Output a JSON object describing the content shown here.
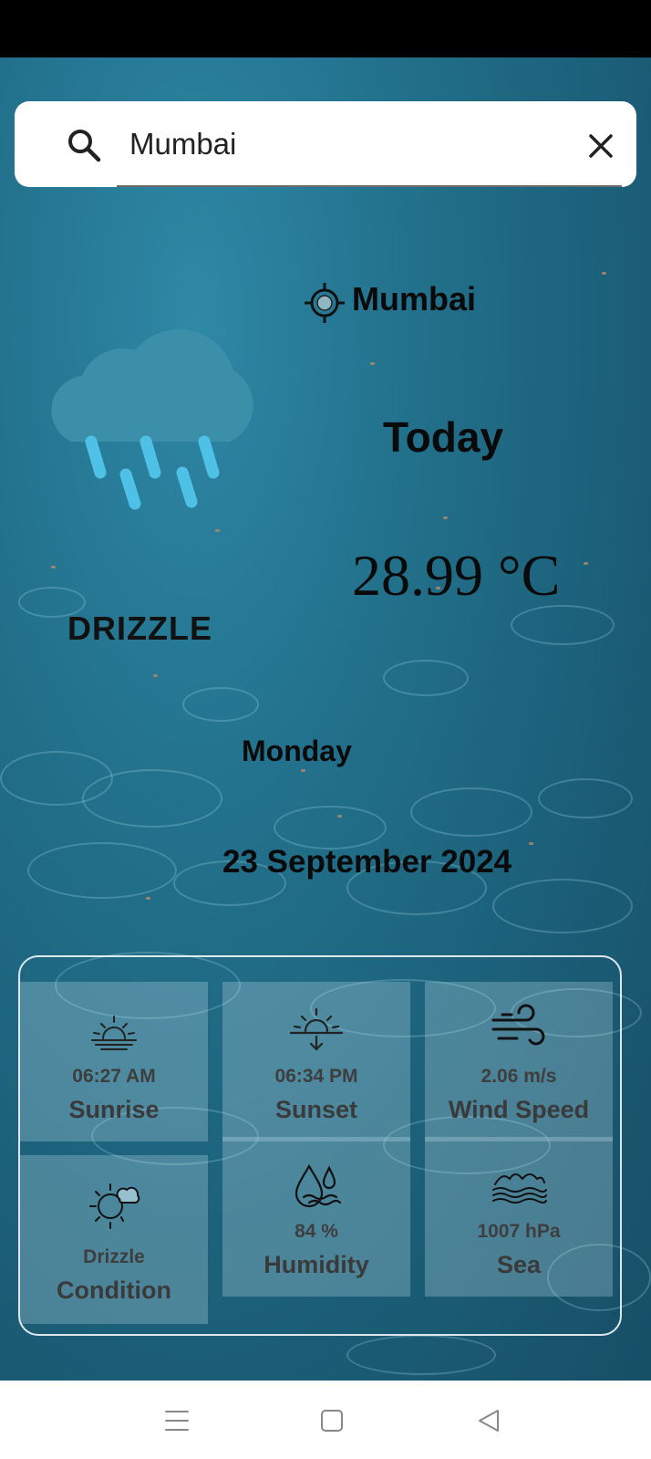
{
  "search": {
    "value": "Mumbai",
    "placeholder": ""
  },
  "location": {
    "name": "Mumbai"
  },
  "today_label": "Today",
  "temperature": "28.99 °C",
  "condition_main": "DRIZZLE",
  "day": "Monday",
  "date": "23 September 2024",
  "details": [
    {
      "icon": "sunrise-icon",
      "value": "06:27 AM",
      "label": "Sunrise"
    },
    {
      "icon": "sunset-icon",
      "value": "06:34 PM",
      "label": "Sunset"
    },
    {
      "icon": "wind-icon",
      "value": "2.06 m/s",
      "label": "Wind Speed"
    },
    {
      "icon": "partly-cloudy-icon",
      "value": "Drizzle",
      "label": "Condition"
    },
    {
      "icon": "humidity-icon",
      "value": "84 %",
      "label": "Humidity"
    },
    {
      "icon": "sea-waves-icon",
      "value": "1007 hPa",
      "label": "Sea"
    }
  ],
  "colors": {
    "cloud": "#3b8fa8",
    "rain": "#4fc1e6",
    "background": "#22708b"
  },
  "navbar": {
    "buttons": [
      "menu-icon",
      "home-icon",
      "back-icon"
    ]
  }
}
